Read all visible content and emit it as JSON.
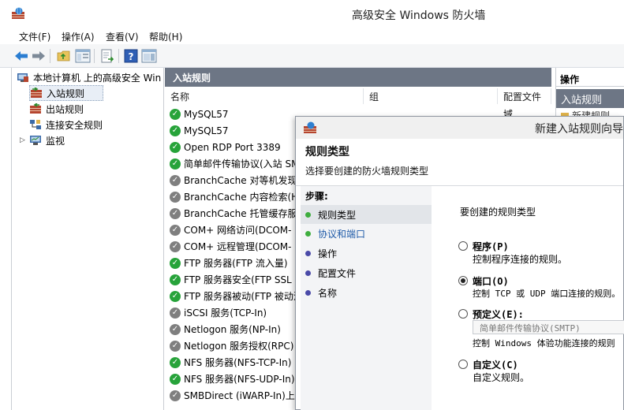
{
  "window": {
    "title": "高级安全 Windows 防火墙"
  },
  "menu": [
    "文件(F)",
    "操作(A)",
    "查看(V)",
    "帮助(H)"
  ],
  "toolbar": {
    "buttons": [
      "back-icon",
      "forward-icon",
      "folder-up-icon",
      "show-hide-tree-icon",
      "export-list-icon",
      "help-icon",
      "action-pane-icon"
    ]
  },
  "tree": {
    "root": "本地计算机 上的高级安全 Win",
    "items": [
      "入站规则",
      "出站规则",
      "连接安全规则",
      "监视"
    ]
  },
  "center": {
    "header": "入站规则",
    "columns": [
      "名称",
      "组",
      "配置文件"
    ],
    "rules": [
      {
        "name": "MySQL57",
        "enabled": true
      },
      {
        "name": "MySQL57",
        "enabled": true
      },
      {
        "name": "Open RDP Port 3389",
        "enabled": true
      },
      {
        "name": "简单邮件传输协议(入站 SM",
        "enabled": true
      },
      {
        "name": "BranchCache 对等机发现",
        "enabled": false
      },
      {
        "name": "BranchCache 内容检索(H",
        "enabled": false
      },
      {
        "name": "BranchCache 托管缓存服",
        "enabled": false
      },
      {
        "name": "COM+ 网络访问(DCOM-",
        "enabled": false
      },
      {
        "name": "COM+ 远程管理(DCOM-",
        "enabled": false
      },
      {
        "name": "FTP 服务器(FTP 流入量)",
        "enabled": true
      },
      {
        "name": "FTP 服务器安全(FTP SSL 流",
        "enabled": true
      },
      {
        "name": "FTP 服务器被动(FTP 被动流",
        "enabled": true
      },
      {
        "name": "iSCSI 服务(TCP-In)",
        "enabled": false
      },
      {
        "name": "Netlogon 服务(NP-In)",
        "enabled": false
      },
      {
        "name": "Netlogon 服务授权(RPC)",
        "enabled": false
      },
      {
        "name": "NFS 服务器(NFS-TCP-In)",
        "enabled": true
      },
      {
        "name": "NFS 服务器(NFS-UDP-In)",
        "enabled": true
      },
      {
        "name": "SMBDirect (iWARP-In)上",
        "enabled": false
      }
    ],
    "profile_first": "域"
  },
  "actions": {
    "header": "操作",
    "section": "入站规则",
    "first_item": "新建规则..."
  },
  "wizard": {
    "title": "新建入站规则向导",
    "heading": "规则类型",
    "subheading": "选择要创建的防火墙规则类型",
    "steps_label": "步骤:",
    "steps": [
      "规则类型",
      "协议和端口",
      "操作",
      "配置文件",
      "名称"
    ],
    "prompt": "要创建的规则类型",
    "options": [
      {
        "label": "程序(P)",
        "desc": "控制程序连接的规则。",
        "selected": false
      },
      {
        "label": "端口(O)",
        "desc": "控制 TCP 或 UDP 端口连接的规则。",
        "selected": true
      },
      {
        "label": "预定义(E):",
        "dropdown": "简单邮件传输协议(SMTP)",
        "desc": "控制 Windows 体验功能连接的规则",
        "selected": false
      },
      {
        "label": "自定义(C)",
        "desc": "自定义规则。",
        "selected": false
      }
    ]
  },
  "colors": {
    "panel_header": "#6d7685",
    "enabled_check": "#27a33a",
    "disabled_check": "#7f7f7f",
    "step_current_dot": "#3fae3f",
    "step_other_dot": "#4a4aa8"
  }
}
